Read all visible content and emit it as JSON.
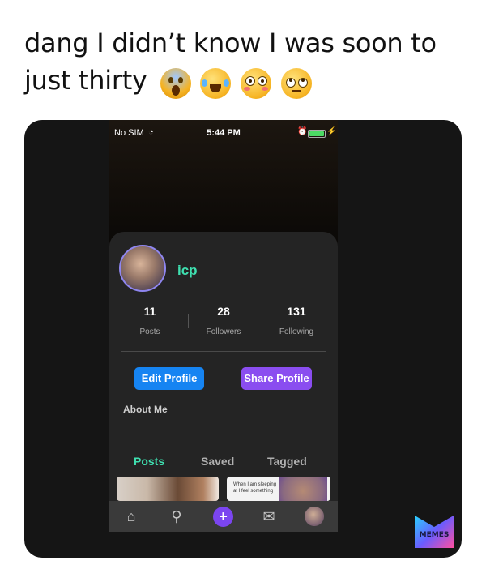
{
  "caption": "dang I didn’t know I was soon to just thirty",
  "emojis": [
    "screaming-face",
    "tears-of-joy-face",
    "flushed-face",
    "eye-roll-face"
  ],
  "status_bar": {
    "carrier": "No SIM",
    "time": "5:44 PM"
  },
  "profile": {
    "username": "icp",
    "stats": [
      {
        "value": "11",
        "label": "Posts"
      },
      {
        "value": "28",
        "label": "Followers"
      },
      {
        "value": "131",
        "label": "Following"
      }
    ],
    "edit_button": "Edit Profile",
    "share_button": "Share Profile",
    "about": "About Me",
    "tabs": [
      "Posts",
      "Saved",
      "Tagged"
    ],
    "post_preview_text": "When I am sleeping at I feel something"
  },
  "bottom_nav": [
    "home-icon",
    "search-icon",
    "add-icon",
    "messages-icon",
    "profile-avatar"
  ],
  "watermark": "MEMES",
  "colors": {
    "accent_green": "#3fe0b0",
    "edit_blue": "#1684f2",
    "share_purple": "#8a4df0",
    "plus_purple": "#7b45f0"
  }
}
